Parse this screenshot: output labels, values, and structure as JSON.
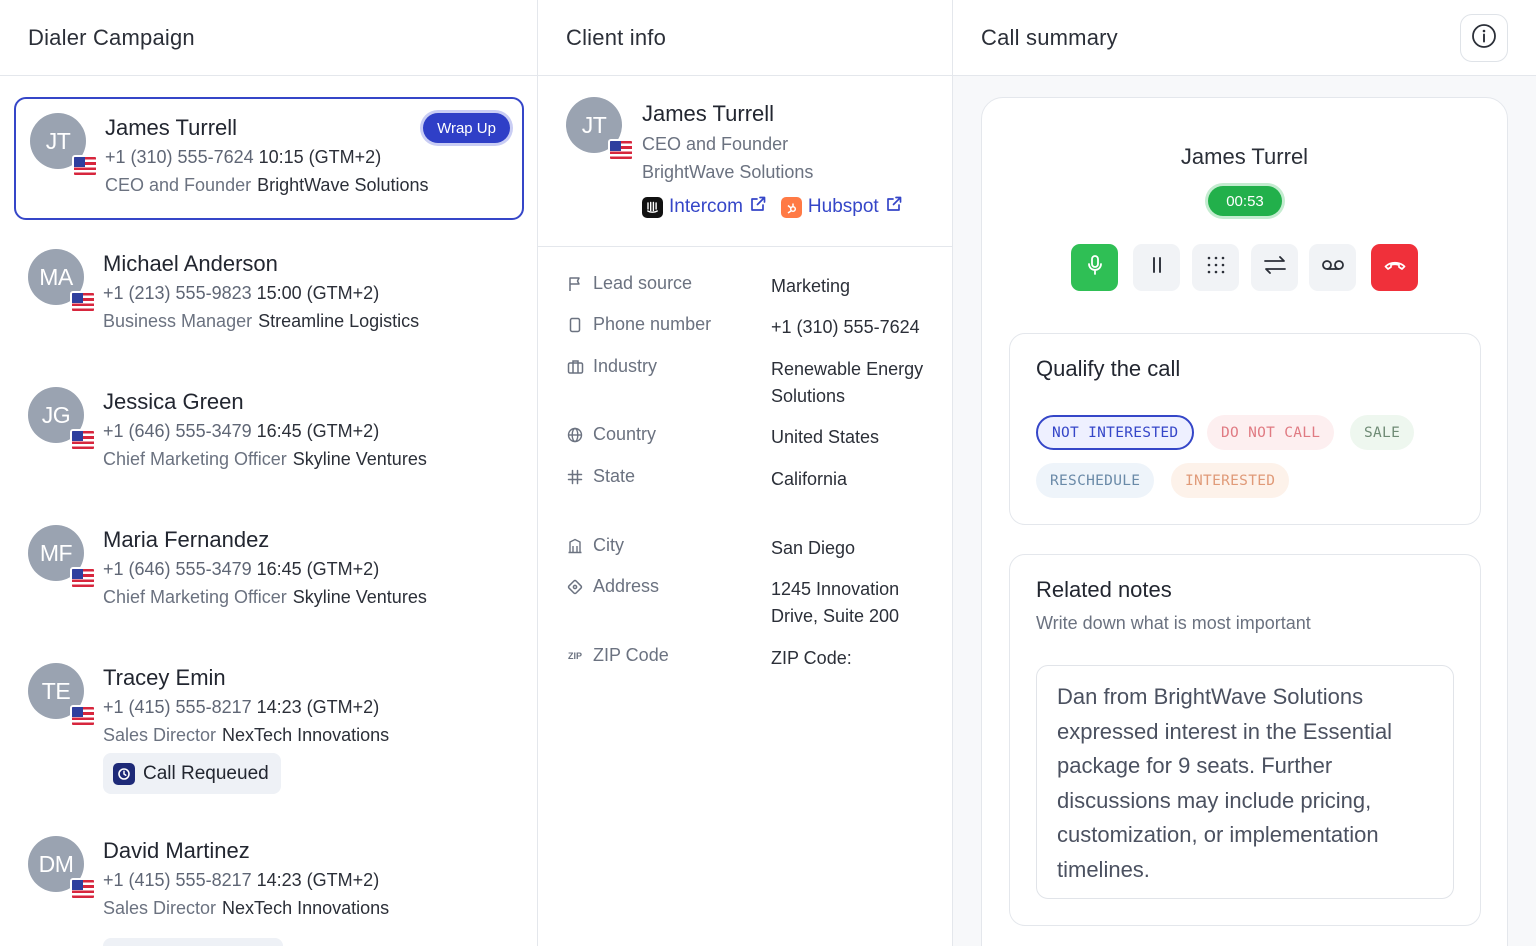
{
  "columns": {
    "dialer_title": "Dialer Campaign",
    "client_title": "Client info",
    "summary_title": "Call summary"
  },
  "contacts": [
    {
      "initials": "JT",
      "name": "James Turrell",
      "phone": "+1 (310) 555-7624",
      "time": "10:15 (GTM+2)",
      "role": "CEO and Founder",
      "company": "BrightWave Solutions",
      "badge": "Wrap Up"
    },
    {
      "initials": "MA",
      "name": "Michael Anderson",
      "phone": "+1 (213) 555-9823",
      "time": "15:00 (GTM+2)",
      "role": "Business Manager",
      "company": "Streamline Logistics"
    },
    {
      "initials": "JG",
      "name": "Jessica Green",
      "phone": "+1 (646) 555-3479",
      "time": "16:45 (GTM+2)",
      "role": "Chief Marketing Officer",
      "company": "Skyline Ventures"
    },
    {
      "initials": "MF",
      "name": "Maria Fernandez",
      "phone": "+1 (646) 555-3479",
      "time": "16:45 (GTM+2)",
      "role": "Chief Marketing Officer",
      "company": "Skyline Ventures"
    },
    {
      "initials": "TE",
      "name": "Tracey Emin",
      "phone": "+1 (415) 555-8217",
      "time": "14:23 (GTM+2)",
      "role": "Sales Director",
      "company": "NexTech Innovations",
      "status": "Call Requeued"
    },
    {
      "initials": "DM",
      "name": "David Martinez",
      "phone": "+1 (415) 555-8217",
      "time": "14:23 (GTM+2)",
      "role": "Sales Director",
      "company": "NexTech Innovations"
    }
  ],
  "client": {
    "initials": "JT",
    "name": "James Turrell",
    "title": "CEO and Founder",
    "company": "BrightWave Solutions",
    "links": [
      {
        "label": "Intercom",
        "icon": "intercom-logo"
      },
      {
        "label": "Hubspot",
        "icon": "hubspot-logo"
      }
    ],
    "fields": [
      {
        "label": "Lead source",
        "value": "Marketing",
        "icon": "flag-icon"
      },
      {
        "label": "Phone number",
        "value": "+1 (310) 555-7624",
        "icon": "phone-icon"
      },
      {
        "label": "Industry",
        "value": "Renewable Energy Solutions",
        "icon": "briefcase-icon"
      },
      {
        "label": "Country",
        "value": "United States",
        "icon": "globe-icon"
      },
      {
        "label": "State",
        "value": "California",
        "icon": "hash-icon"
      },
      {
        "label": "City",
        "value": "San Diego",
        "icon": "building-icon"
      },
      {
        "label": "Address",
        "value": "1245 Innovation Drive, Suite 200",
        "icon": "location-icon"
      },
      {
        "label": "ZIP Code",
        "value": "ZIP Code:",
        "icon": "zip-icon"
      }
    ]
  },
  "call": {
    "name": "James Turrel",
    "timer": "00:53",
    "qualify_title": "Qualify the call",
    "tags": [
      "NOT INTERESTED",
      "DO NOT CALL",
      "SALE",
      "RESCHEDULE",
      "INTERESTED"
    ],
    "notes_title": "Related notes",
    "notes_subtitle": "Write down what is most important",
    "notes_text": "Dan from BrightWave Solutions expressed interest in the Essential package for 9 seats. Further discussions may include pricing, customization, or implementation timelines."
  },
  "colors": {
    "accent": "#3546c8",
    "mic_green": "#2fbf55",
    "hangup_red": "#f0303a",
    "timer_green": "#22b04b"
  }
}
